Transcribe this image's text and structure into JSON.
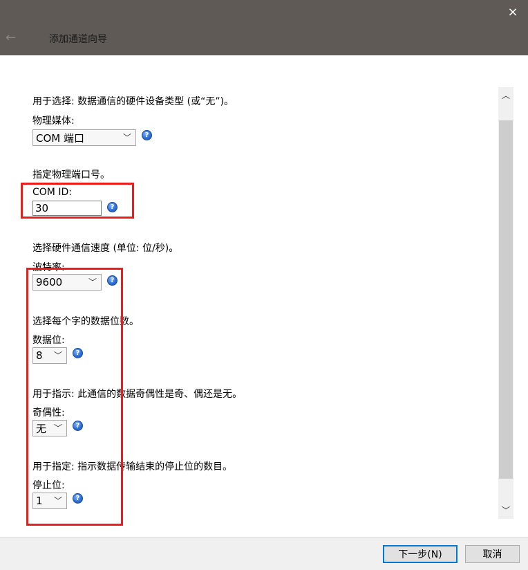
{
  "window": {
    "close_icon": "×",
    "back_icon": "←",
    "title": "添加通道向导"
  },
  "form": {
    "media_desc": "用于选择: 数据通信的硬件设备类型 (或“无”)。",
    "media_label": "物理媒体:",
    "media_value": "COM 端口",
    "port_desc": "指定物理端口号。",
    "com_id_label": "COM ID:",
    "com_id_value": "30",
    "baud_desc": "选择硬件通信速度 (单位: 位/秒)。",
    "baud_label": "波特率:",
    "baud_value": "9600",
    "databits_desc": "选择每个字的数据位数。",
    "databits_label": "数据位:",
    "databits_value": "8",
    "parity_desc": "用于指示: 此通信的数据奇偶性是奇、偶还是无。",
    "parity_label": "奇偶性:",
    "parity_value": "无",
    "stopbits_desc": "用于指定: 指示数据传输结束的停止位的数目。",
    "stopbits_label": "停止位:",
    "stopbits_value": "1",
    "dropdown_icon": "﹀",
    "help_icon": "?"
  },
  "scrollbar": {
    "up_icon": "︿",
    "down_icon": "﹀"
  },
  "footer": {
    "next_label": "下一步(N)",
    "cancel_label": "取消"
  },
  "colors": {
    "titlebar": "#5f5a55",
    "highlight": "#ea1c1c",
    "accent": "#0078d7"
  }
}
